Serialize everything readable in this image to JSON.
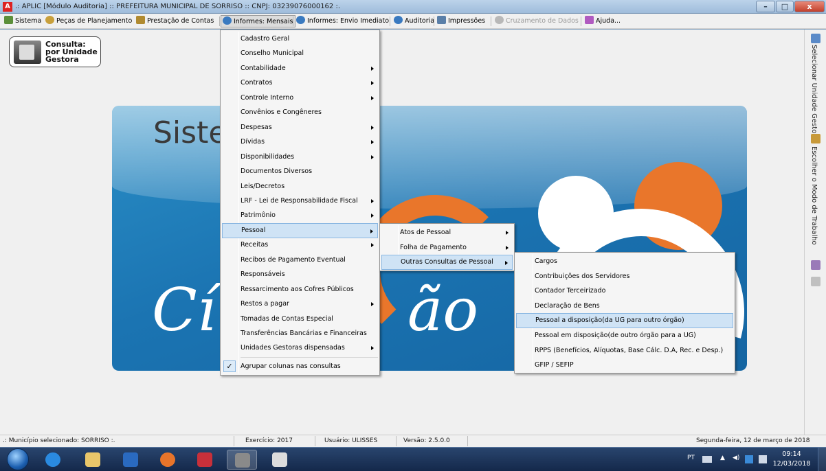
{
  "window": {
    "title": ".: APLIC [Módulo Auditoria] :: PREFEITURA MUNICIPAL DE SORRISO :: CNPJ: 03239076000162 :.",
    "app_icon_letter": "A",
    "min_glyph": "–",
    "max_glyph": "□",
    "close_glyph": "x"
  },
  "menubar": {
    "sistema": "Sistema",
    "pecas": "Peças de Planejamento",
    "prestacao": "Prestação de Contas",
    "informes_mensais": "Informes: Mensais",
    "informes_envio": "Informes: Envio Imediato",
    "auditoria": "Auditoria",
    "impressoes": "Impressões",
    "cruzamento": "Cruzamento de Dados",
    "ajuda": "Ajuda..."
  },
  "consulta_button": {
    "line1": "Consulta:",
    "line2": "por Unidade",
    "line3": "Gestora"
  },
  "right_panel": {
    "selecionar": "Selecionar Unidade Gestora",
    "escolher": "Escolher o Modo de Trabalho"
  },
  "banner": {
    "sistema_text": "Sister",
    "cidadao_left": "Cí",
    "cidadao_right": "ão"
  },
  "main_menu": {
    "items": [
      "Cadastro Geral",
      "Conselho Municipal",
      "Contabilidade",
      "Contratos",
      "Controle Interno",
      "Convênios e Congêneres",
      "Despesas",
      "Dívidas",
      "Disponibilidades",
      "Documentos Diversos",
      "Leis/Decretos",
      "LRF - Lei de Responsabilidade Fiscal",
      "Patrimônio",
      "Pessoal",
      "Receitas",
      "Recibos de Pagamento Eventual",
      "Responsáveis",
      "Ressarcimento aos Cofres Públicos",
      "Restos a pagar",
      "Tomadas de Contas Especial",
      "Transferências Bancárias e Financeiras",
      "Unidades Gestoras dispensadas"
    ],
    "check_item": "Agrupar colunas nas consultas",
    "check_glyph": "✓"
  },
  "pessoal_menu": {
    "items": [
      "Atos de Pessoal",
      "Folha de Pagamento",
      "Outras Consultas de Pessoal"
    ]
  },
  "outras_menu": {
    "items": [
      "Cargos",
      "Contribuições dos Servidores",
      "Contador Terceirizado",
      "Declaração de Bens",
      "Pessoal a disposição(da UG para outro órgão)",
      "Pessoal em disposição(de outro órgão para a UG)",
      "RPPS (Benefícios, Alíquotas, Base Cálc. D.A, Rec. e Desp.)",
      "GFIP / SEFIP"
    ]
  },
  "statusbar": {
    "municipio": ".: Município selecionado: SORRISO :.",
    "exercicio": "Exercício: 2017",
    "usuario": "Usuário:  ULISSES",
    "versao": "Versão: 2.5.0.0",
    "data": "Segunda-feira, 12 de março de 2018"
  },
  "taskbar": {
    "lang": "PT",
    "time": "09:14",
    "date": "12/03/2018"
  }
}
